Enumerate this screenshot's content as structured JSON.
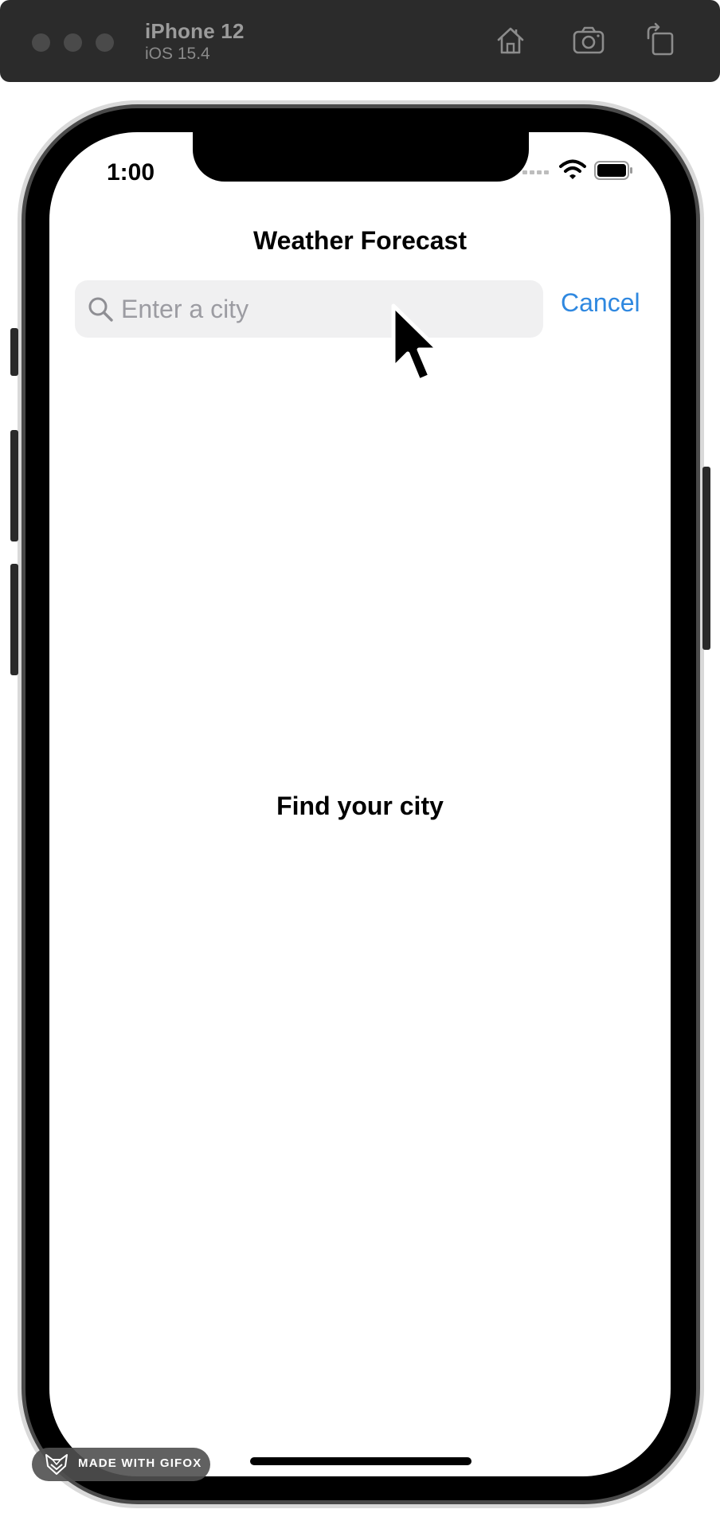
{
  "simulator": {
    "device_name": "iPhone 12",
    "os_version": "iOS 15.4",
    "icons": [
      "home-icon",
      "screenshot-icon",
      "rotate-icon"
    ]
  },
  "status_bar": {
    "time": "1:00",
    "icons": [
      "signal-icon",
      "wifi-icon",
      "battery-icon"
    ]
  },
  "nav": {
    "title": "Weather Forecast"
  },
  "search": {
    "placeholder": "Enter a city",
    "value": "",
    "cancel_label": "Cancel"
  },
  "content": {
    "empty_message": "Find your city"
  },
  "watermark": {
    "label": "MADE WITH GIFOX"
  },
  "colors": {
    "accent": "#2f88e0",
    "search_background": "#f0f0f1",
    "placeholder": "#9c9ca2",
    "toolbar": "#2b2b2b"
  }
}
